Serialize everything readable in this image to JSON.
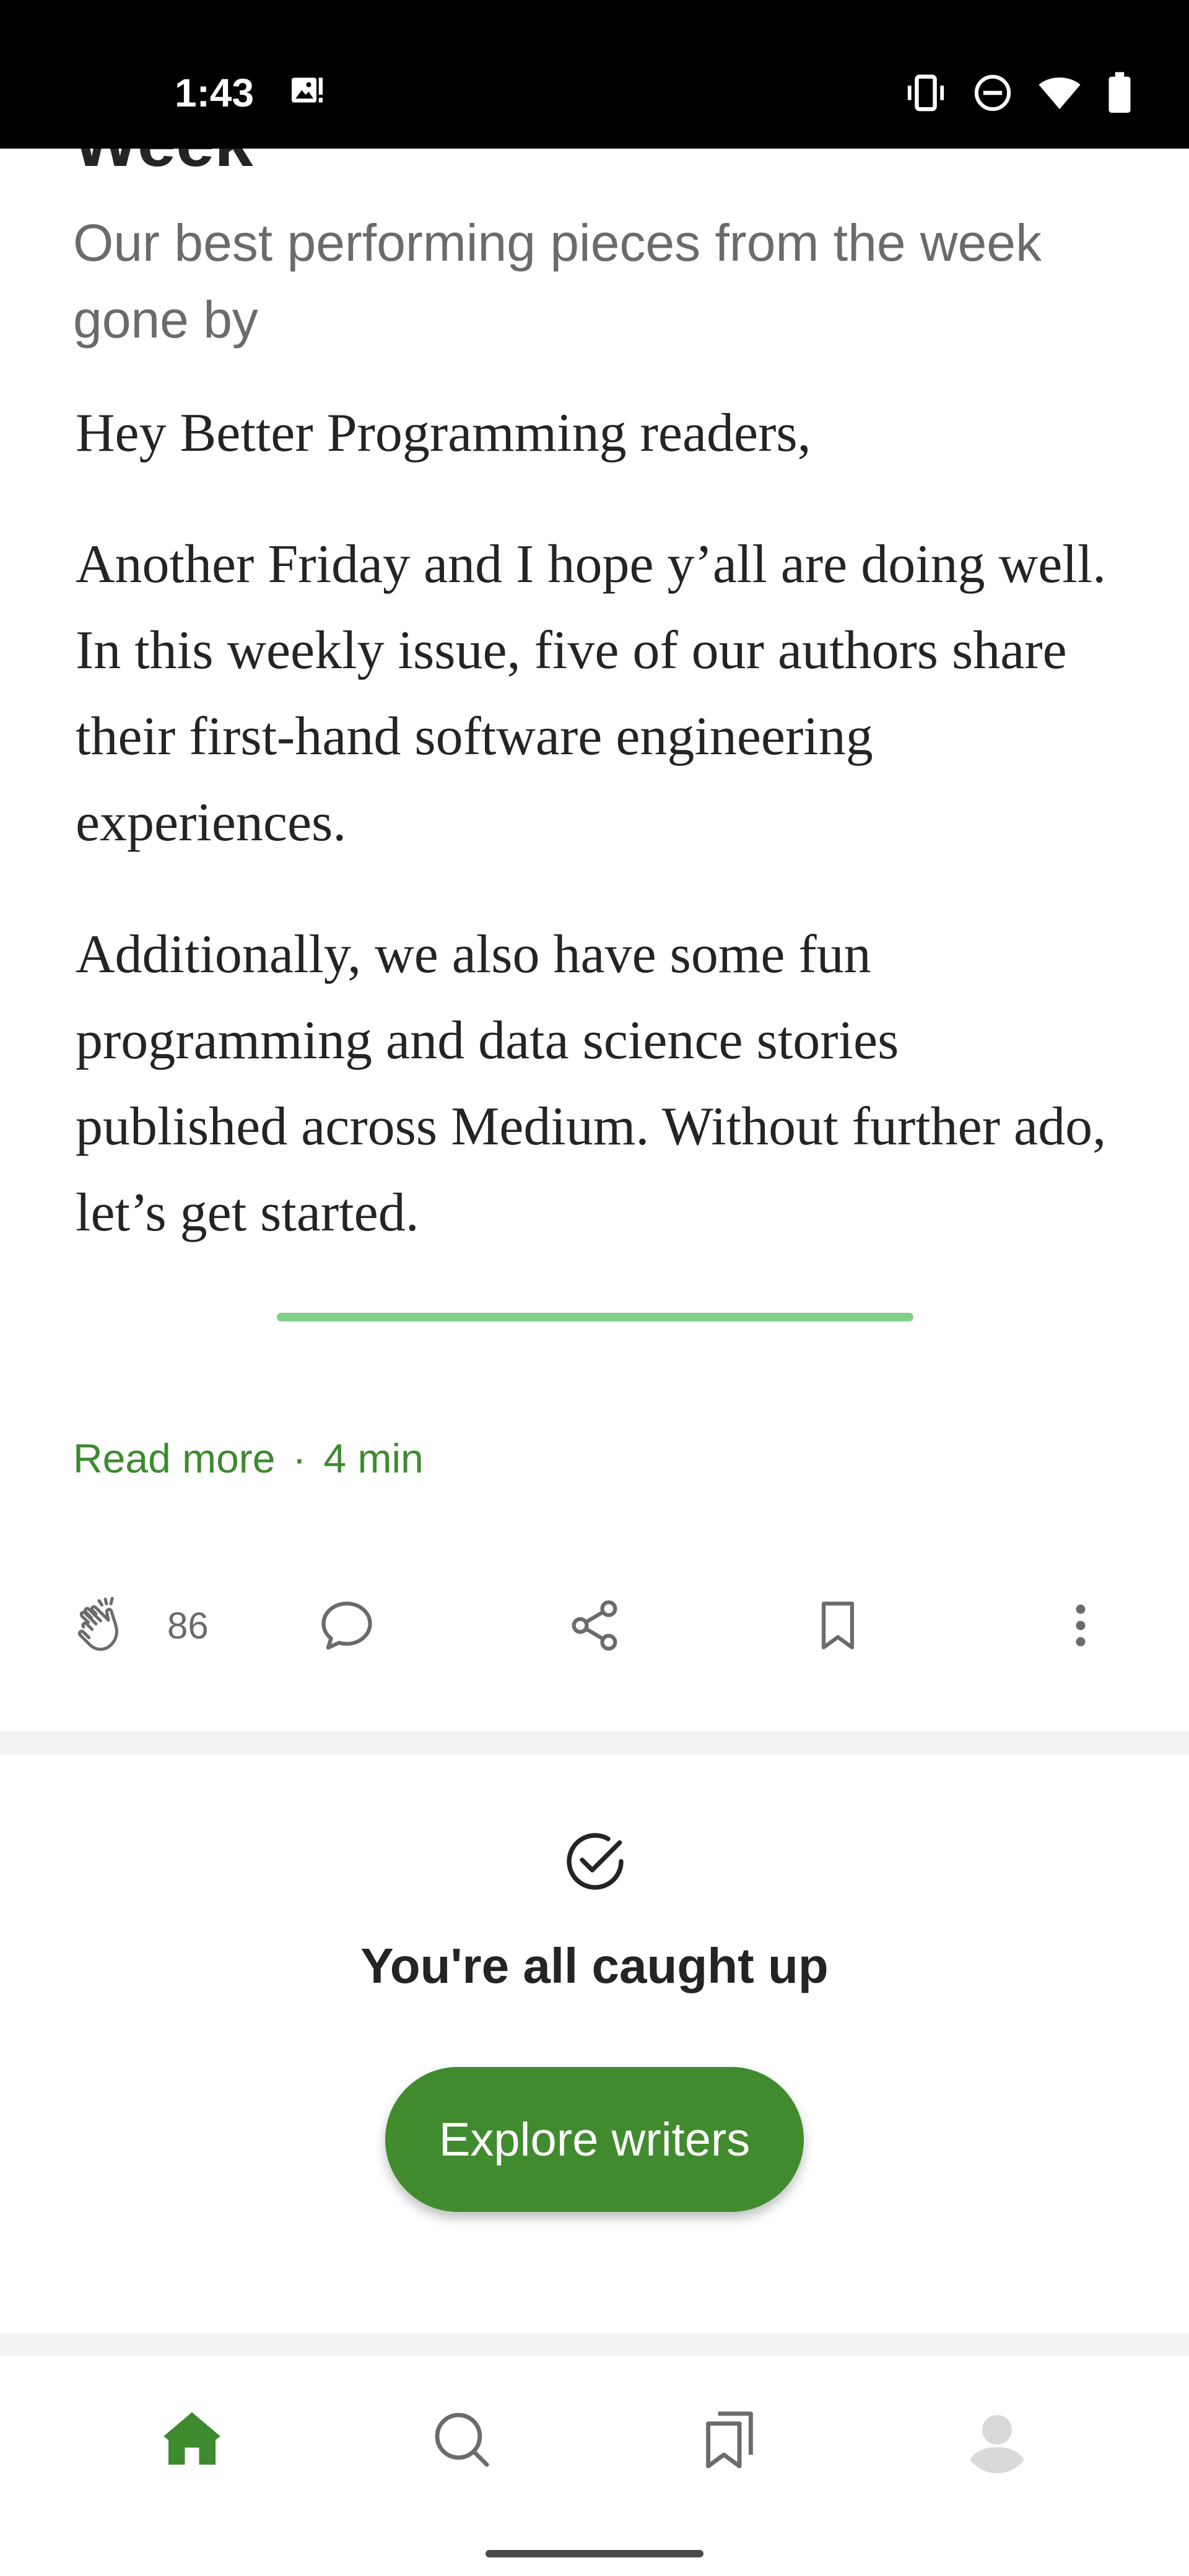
{
  "status_bar": {
    "time": "1:43"
  },
  "article": {
    "heading_partial": "Week",
    "subtitle": "Our best performing pieces from the week gone by",
    "paragraphs": [
      "Hey Better Programming readers,",
      "Another Friday and I hope y’all are doing well. In this weekly issue, five of our authors share their first-hand software engineering experiences.",
      "Additionally, we also have some fun programming and data science stories published across Medium. Without further ado, let’s get started."
    ],
    "read_more_label": "Read more",
    "separator": "·",
    "read_time": "4 min",
    "clap_count": "86"
  },
  "feed_end": {
    "caught_up_text": "You're all caught up",
    "explore_button_label": "Explore writers"
  },
  "colors": {
    "accent": "#418b2f",
    "link": "#3d8a2f",
    "divider": "#7fd18a",
    "text": "#242424",
    "muted": "#6b6b6b"
  },
  "icons": {
    "status": [
      "image-notification-icon",
      "vibrate-icon",
      "do-not-disturb-icon",
      "wifi-icon",
      "battery-icon"
    ],
    "actions": [
      "clap-icon",
      "comment-icon",
      "share-icon",
      "bookmark-icon",
      "more-options-icon"
    ],
    "nav": [
      "home-icon",
      "search-icon",
      "bookmarks-icon",
      "profile-icon"
    ]
  }
}
